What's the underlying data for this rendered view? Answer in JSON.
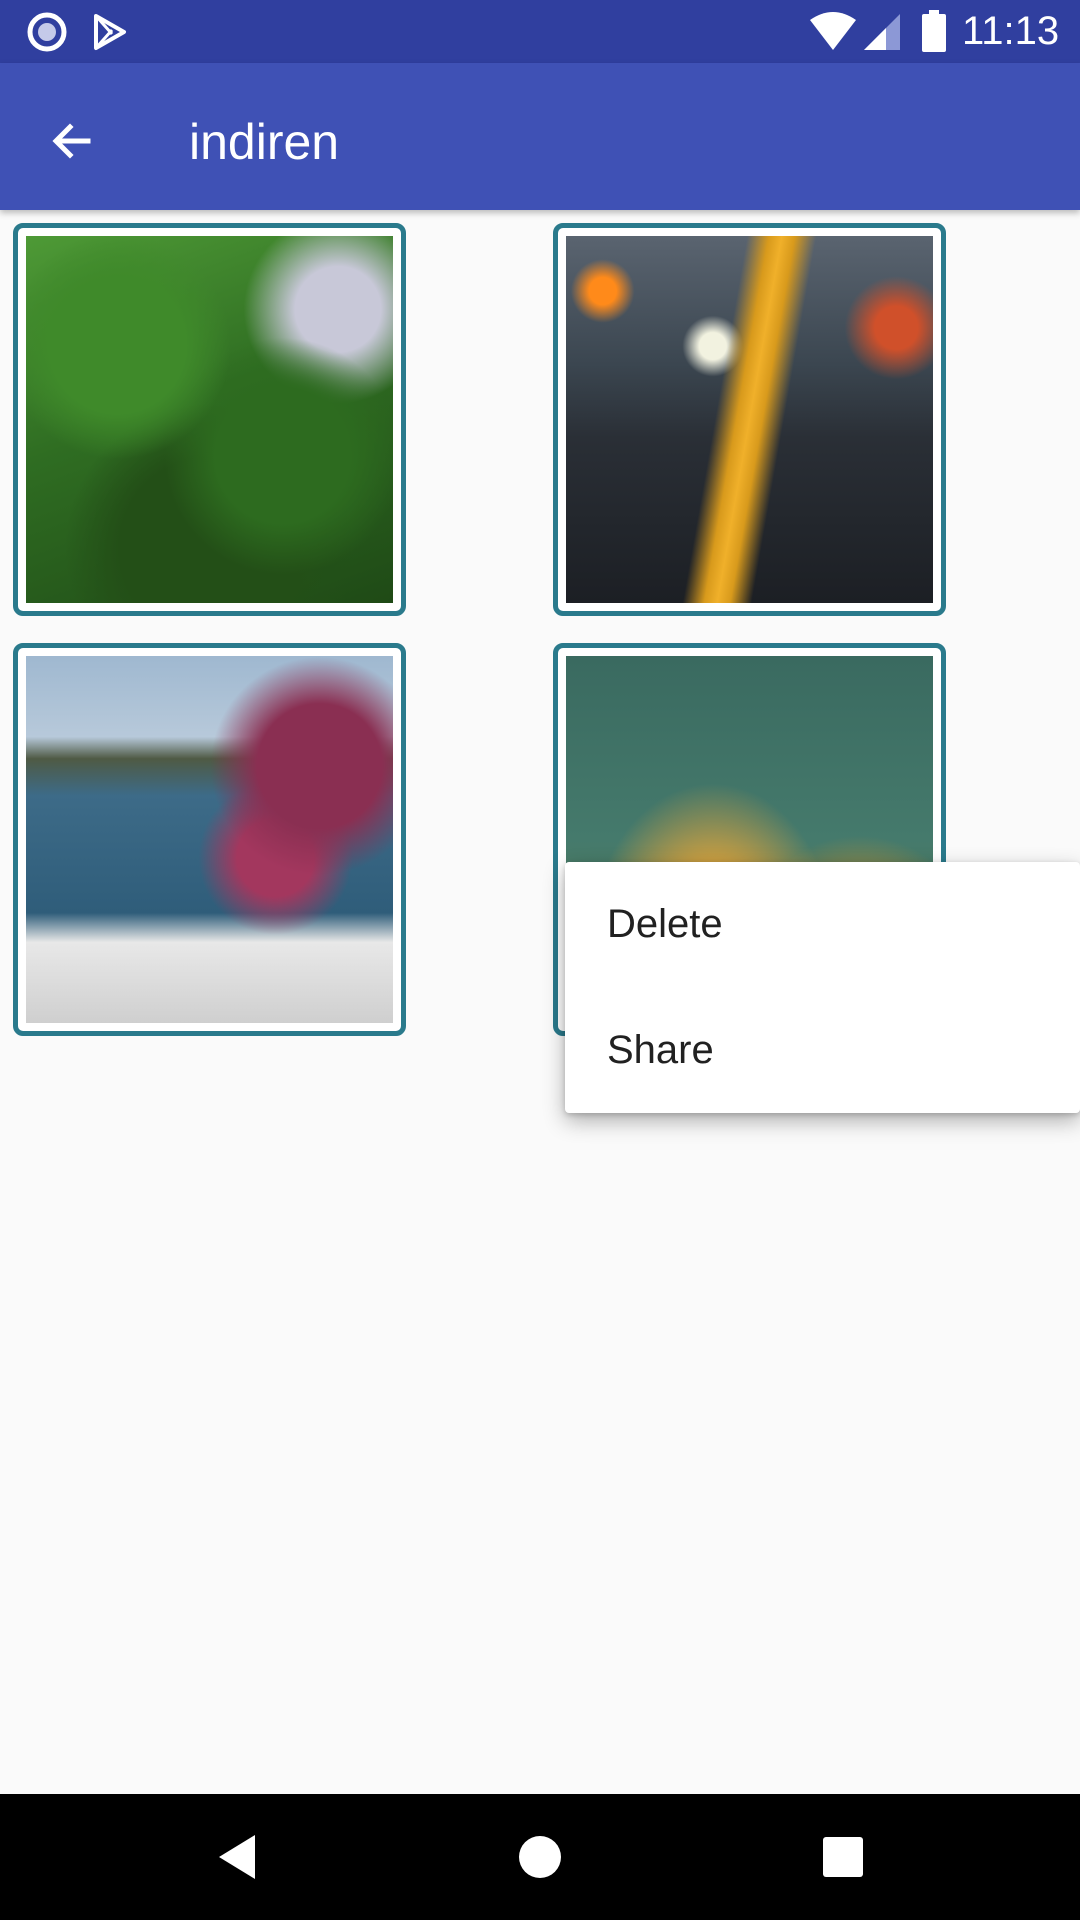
{
  "status_bar": {
    "time": "11:13",
    "icons": [
      "record-icon",
      "play-store-icon",
      "wifi-icon",
      "cell-signal-icon",
      "battery-icon"
    ]
  },
  "app_bar": {
    "title": "indiren",
    "back_icon": "arrow-back-icon"
  },
  "colors": {
    "status_bar": "#303f9f",
    "app_bar": "#3f51b5",
    "tile_border": "#2a7a8c",
    "background": "#fafafa"
  },
  "gallery": {
    "images": [
      {
        "subject": "trees"
      },
      {
        "subject": "street"
      },
      {
        "subject": "harbor"
      },
      {
        "subject": "sky"
      }
    ]
  },
  "context_menu": {
    "items": [
      {
        "label": "Delete"
      },
      {
        "label": "Share"
      }
    ]
  },
  "nav_bar": {
    "buttons": [
      "back-triangle-icon",
      "home-circle-icon",
      "recents-square-icon"
    ]
  }
}
